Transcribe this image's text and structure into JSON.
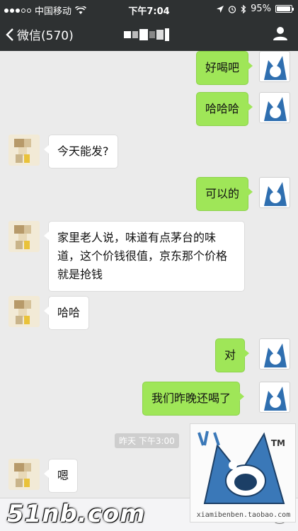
{
  "status_bar": {
    "carrier": "中国移动",
    "time": "下午7:04",
    "battery_percent": "95%",
    "battery_level": 0.95
  },
  "nav": {
    "back_label": "微信(570)"
  },
  "messages": [
    {
      "side": "self",
      "text": "好喝吧"
    },
    {
      "side": "self",
      "text": "哈哈哈"
    },
    {
      "side": "other",
      "text": "今天能发?"
    },
    {
      "side": "self",
      "text": "可以的"
    },
    {
      "side": "other",
      "text": "家里老人说，味道有点茅台的味道，这个价钱很值，京东那个价格就是抢钱"
    },
    {
      "side": "other",
      "text": "哈哈"
    },
    {
      "side": "self",
      "text": "对"
    },
    {
      "side": "self",
      "text": "我们昨晚还喝了"
    },
    {
      "side": "other",
      "text": "嗯"
    }
  ],
  "timestamp": "昨天 下午3:00",
  "sticker": {
    "url": "xiamibenben.taobao.com",
    "text": "TM"
  },
  "watermark": "51nb.com",
  "colors": {
    "nav_bg": "#2e3132",
    "self_bubble": "#9fe658",
    "other_bubble": "#ffffff",
    "chat_bg": "#ebebeb"
  }
}
